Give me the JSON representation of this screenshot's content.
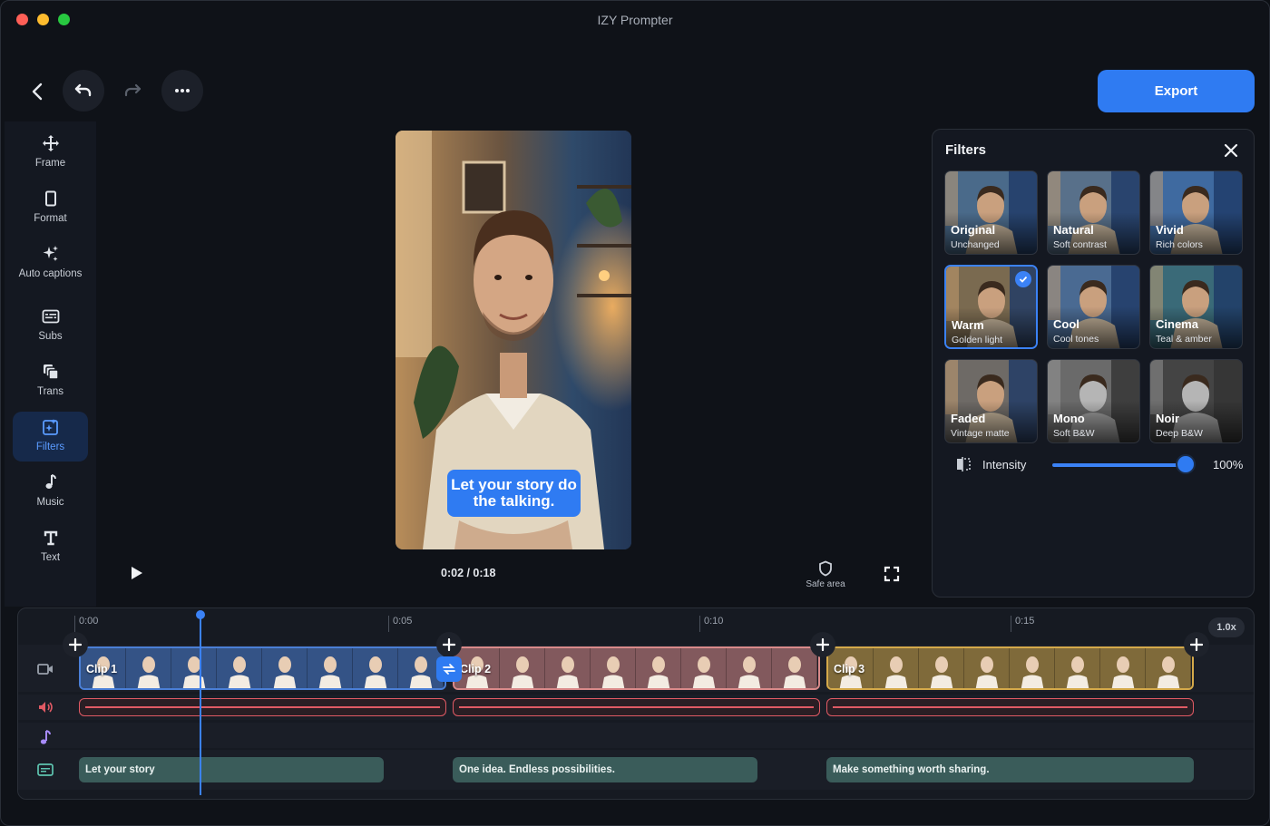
{
  "window": {
    "title": "IZY Prompter"
  },
  "toolbar": {
    "export_label": "Export"
  },
  "sidebar": {
    "items": [
      {
        "label": "Frame",
        "icon": "move-icon"
      },
      {
        "label": "Format",
        "icon": "format-icon"
      },
      {
        "label": "Auto captions",
        "icon": "sparkles-icon"
      },
      {
        "label": "Subs",
        "icon": "subtitles-icon"
      },
      {
        "label": "Trans",
        "icon": "transitions-icon"
      },
      {
        "label": "Filters",
        "icon": "filters-icon",
        "active": true
      },
      {
        "label": "Music",
        "icon": "music-icon"
      },
      {
        "label": "Text",
        "icon": "text-icon"
      }
    ]
  },
  "preview": {
    "caption": "Let your story do the talking.",
    "timecode": "0:02 / 0:18",
    "safe_area_label": "Safe area"
  },
  "filters": {
    "title": "Filters",
    "items": [
      {
        "name": "Original",
        "sub": "Unchanged",
        "tint": "#4a6a8a"
      },
      {
        "name": "Natural",
        "sub": "Soft contrast",
        "tint": "#58708a"
      },
      {
        "name": "Vivid",
        "sub": "Rich colors",
        "tint": "#3f6aa0"
      },
      {
        "name": "Warm",
        "sub": "Golden light",
        "tint": "#7a6a50",
        "selected": true
      },
      {
        "name": "Cool",
        "sub": "Cool tones",
        "tint": "#4a6a92"
      },
      {
        "name": "Cinema",
        "sub": "Teal & amber",
        "tint": "#3a6a78"
      },
      {
        "name": "Faded",
        "sub": "Vintage matte",
        "tint": "#6e6a66"
      },
      {
        "name": "Mono",
        "sub": "Soft B&W",
        "tint": "#6a6a6a"
      },
      {
        "name": "Noir",
        "sub": "Deep B&W",
        "tint": "#444444"
      }
    ],
    "intensity_label": "Intensity",
    "intensity_value": "100%",
    "intensity_fraction": 1.0
  },
  "timeline": {
    "ticks": [
      "0:00",
      "0:05",
      "0:10",
      "0:15"
    ],
    "speed": "1.0x",
    "clips": [
      {
        "label": "Clip 1",
        "color": "#4a7fd6"
      },
      {
        "label": "Clip 2",
        "color": "#d98a8a"
      },
      {
        "label": "Clip 3",
        "color": "#d4a94a"
      }
    ],
    "subtitles": [
      "Let your story",
      "One idea. Endless possibilities.",
      "Make something worth sharing."
    ]
  },
  "colors": {
    "accent": "#2f7bf2",
    "audio": "#e05a64",
    "subtitle": "#3a5c5a"
  }
}
